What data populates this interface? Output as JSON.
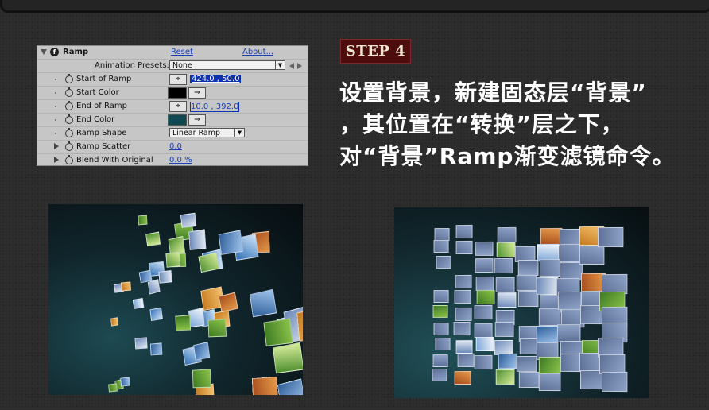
{
  "effect_panel": {
    "effect_name": "Ramp",
    "reset_label": "Reset",
    "about_label": "About...",
    "presets_label": "Animation Presets:",
    "presets_value": "None",
    "properties": [
      {
        "label": "Start of Ramp",
        "value": "424.0 , 50.0"
      },
      {
        "label": "Start Color",
        "color": "#000000"
      },
      {
        "label": "End of Ramp",
        "value": "10.0 , 392.0"
      },
      {
        "label": "End Color",
        "color": "#0f4a52"
      },
      {
        "label": "Ramp Shape",
        "value": "Linear Ramp"
      },
      {
        "label": "Ramp Scatter",
        "value": "0.0"
      },
      {
        "label": "Blend With Original",
        "value": "0.0 %"
      }
    ]
  },
  "step": {
    "label": "STEP 4",
    "description": "设置背景，新建固态层“背景”\n，其位置在“转换”层之下，\n对“背景”Ramp渐变滤镜命令。"
  },
  "colors": {
    "badge_bg": "#4e0d0d",
    "panel_bg": "#c6c6c6",
    "link_blue": "#1a3fb4",
    "page_bg": "#2b2b2b"
  }
}
